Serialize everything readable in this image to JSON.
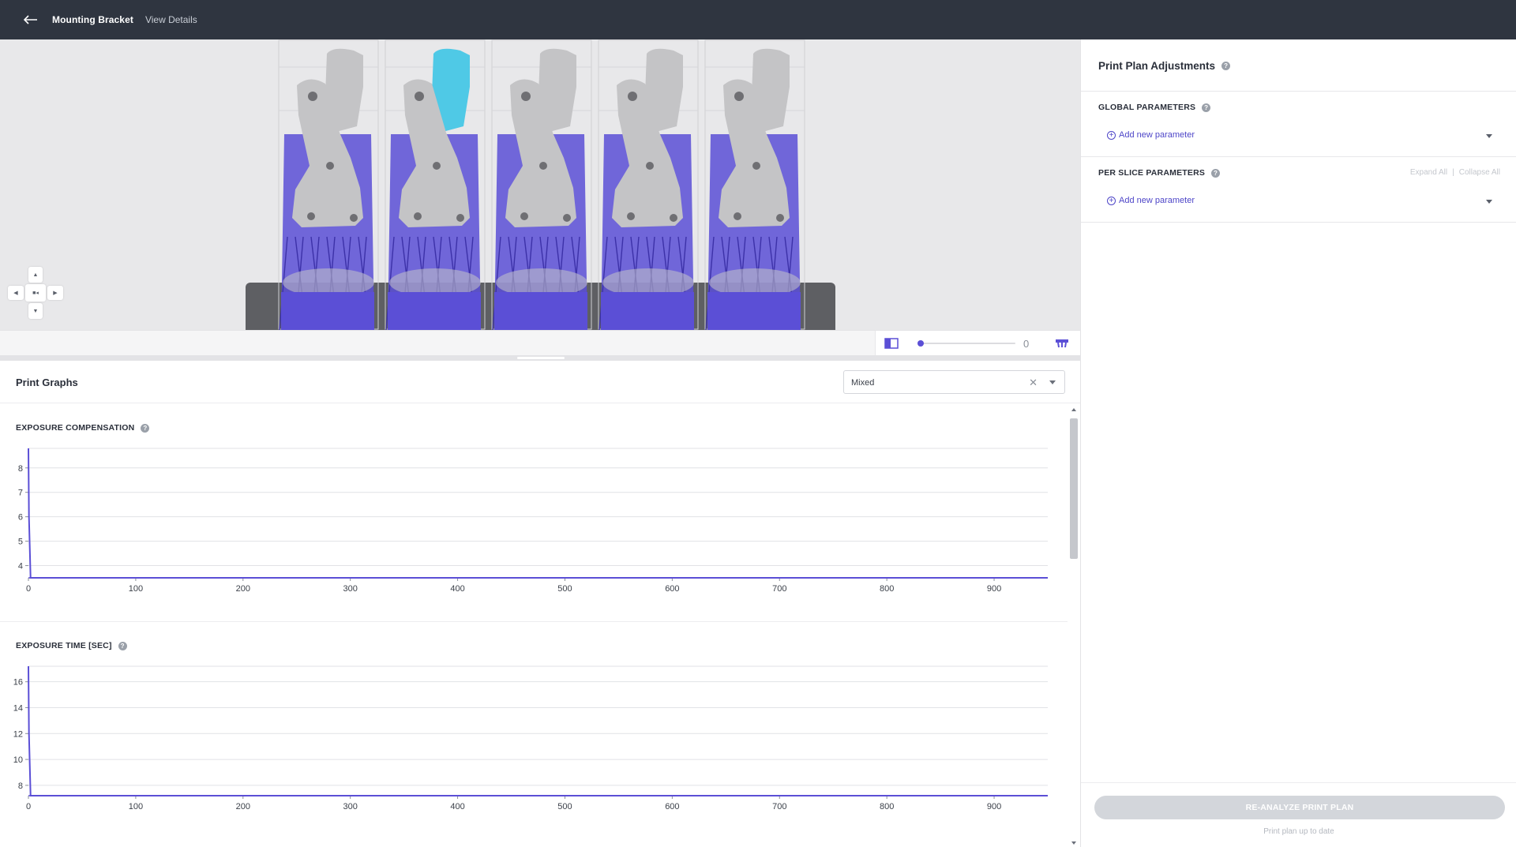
{
  "topbar": {
    "back_icon": "arrow-left-icon",
    "title": "Mounting Bracket",
    "view_details": "View Details"
  },
  "viewport": {
    "parts_count": 5,
    "selected_part_index": 1,
    "colors": {
      "part": "#c4c4c6",
      "support": "#5b4fd6",
      "selected": "#4fc9e6",
      "tray": "#5e5f63",
      "background": "#e8e8ea"
    },
    "slider_value": "0",
    "slider_fraction": 0.0,
    "layout_icon": "split-view-icon",
    "support_icon": "support-tray-icon",
    "nav_icons": [
      "chevron-up-icon",
      "chevron-left-icon",
      "camera-reset-icon",
      "chevron-right-icon",
      "chevron-down-icon"
    ]
  },
  "graphs": {
    "title": "Print Graphs",
    "mode_select": {
      "value": "Mixed",
      "clear_icon": "close-icon",
      "caret_icon": "chevron-down-icon"
    },
    "help_icon": "help-circle-icon"
  },
  "chart_data": [
    {
      "type": "line",
      "title": "EXPOSURE COMPENSATION",
      "xlabel": "",
      "ylabel": "",
      "xlim": [
        0,
        950
      ],
      "ylim": [
        3.5,
        8.8
      ],
      "x_ticks": [
        0,
        100,
        200,
        300,
        400,
        500,
        600,
        700,
        800,
        900
      ],
      "y_ticks": [
        4,
        5,
        6,
        7,
        8
      ],
      "grid": true,
      "series": [
        {
          "x": [
            0,
            0.5,
            2,
            950
          ],
          "y": [
            8.8,
            6.0,
            3.5,
            3.5
          ],
          "color": "#5b4fd6"
        }
      ]
    },
    {
      "type": "line",
      "title": "EXPOSURE TIME [SEC]",
      "xlabel": "",
      "ylabel": "",
      "xlim": [
        0,
        950
      ],
      "ylim": [
        7.2,
        17.2
      ],
      "x_ticks": [
        0,
        100,
        200,
        300,
        400,
        500,
        600,
        700,
        800,
        900
      ],
      "y_ticks": [
        8,
        10,
        12,
        14,
        16
      ],
      "grid": true,
      "series": [
        {
          "x": [
            0,
            0.5,
            2,
            950
          ],
          "y": [
            17.2,
            12.0,
            7.2,
            7.2
          ],
          "color": "#5b4fd6"
        }
      ]
    }
  ],
  "right_panel": {
    "title": "Print Plan Adjustments",
    "global_title": "GLOBAL PARAMETERS",
    "per_slice_title": "PER SLICE PARAMETERS",
    "add_param_label": "Add new parameter",
    "expand_all": "Expand All",
    "separator": "|",
    "collapse_all": "Collapse All",
    "reanalyze_label": "RE-ANALYZE PRINT PLAN",
    "status": "Print plan up to date"
  }
}
